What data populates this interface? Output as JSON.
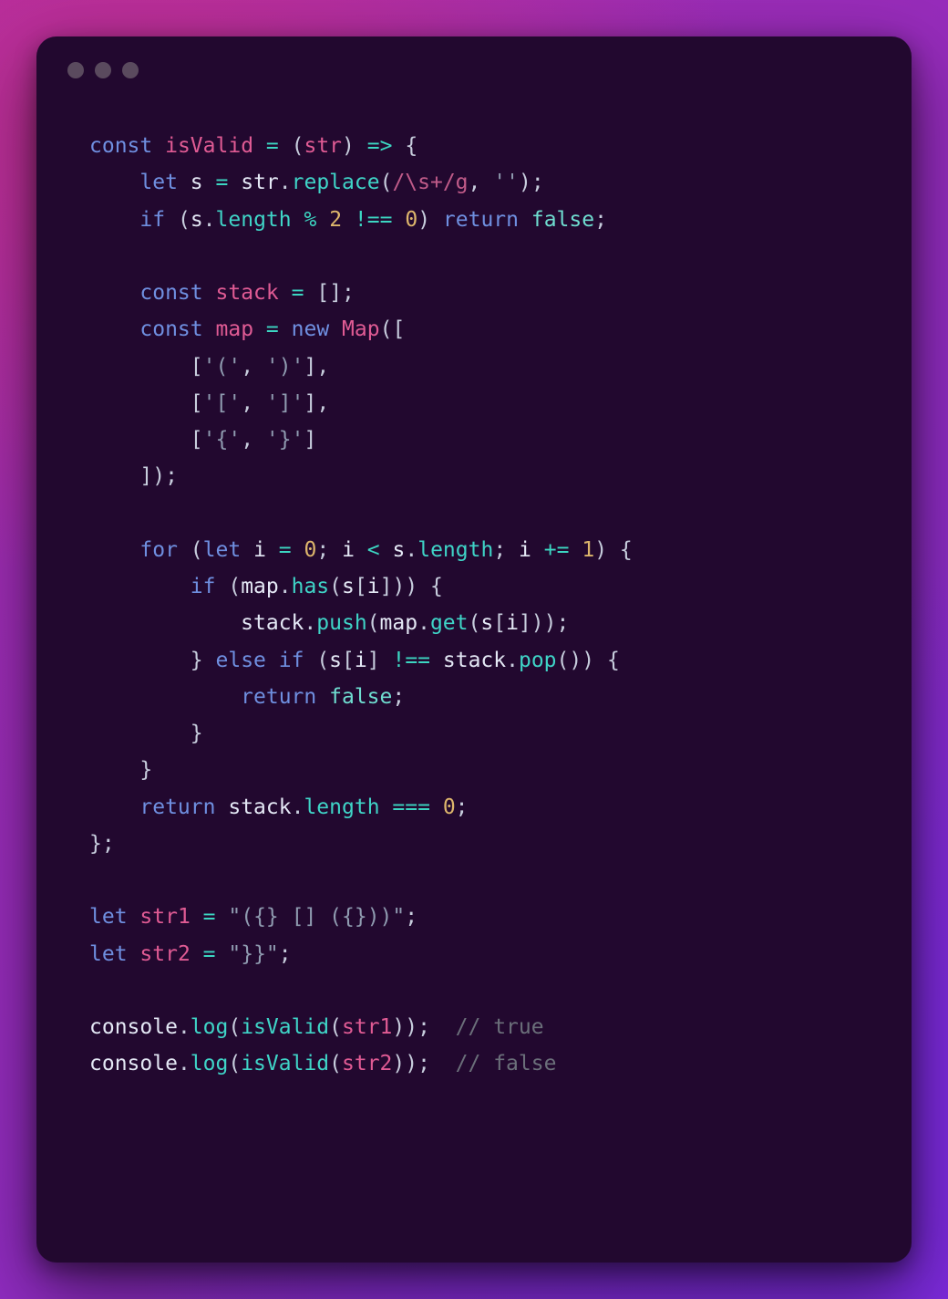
{
  "code": {
    "t1": "const",
    "t2": "isValid",
    "t3": "=",
    "t4": "(",
    "t5": "str",
    "t6": ")",
    "t7": "=>",
    "t8": "{",
    "t9": "let",
    "t10": "s",
    "t11": "=",
    "t12": "str",
    "t13": ".",
    "t14": "replace",
    "t15": "(",
    "t16": "/\\s+/g",
    "t17": ",",
    "t18": "''",
    "t19": ")",
    "t20": ";",
    "t21": "if",
    "t22": "(",
    "t23": "s",
    "t24": ".",
    "t25": "length",
    "t26": "%",
    "t27": "2",
    "t28": "!==",
    "t29": "0",
    "t30": ")",
    "t31": "return",
    "t32": "false",
    "t33": ";",
    "t34": "const",
    "t35": "stack",
    "t36": "=",
    "t37": "[",
    "t38": "]",
    "t39": ";",
    "t40": "const",
    "t41": "map",
    "t42": "=",
    "t43": "new",
    "t44": "Map",
    "t45": "(",
    "t46": "[",
    "t47": "[",
    "t48": "'('",
    "t49": ",",
    "t50": "')'",
    "t51": "]",
    "t52": ",",
    "t53": "[",
    "t54": "'['",
    "t55": ",",
    "t56": "']'",
    "t57": "]",
    "t58": ",",
    "t59": "[",
    "t60": "'{'",
    "t61": ",",
    "t62": "'}'",
    "t63": "]",
    "t64": "]",
    "t65": ")",
    "t66": ";",
    "t67": "for",
    "t68": "(",
    "t69": "let",
    "t70": "i",
    "t71": "=",
    "t72": "0",
    "t73": ";",
    "t74": "i",
    "t75": "<",
    "t76": "s",
    "t77": ".",
    "t78": "length",
    "t79": ";",
    "t80": "i",
    "t81": "+=",
    "t82": "1",
    "t83": ")",
    "t84": "{",
    "t85": "if",
    "t86": "(",
    "t87": "map",
    "t88": ".",
    "t89": "has",
    "t90": "(",
    "t91": "s",
    "t92": "[",
    "t93": "i",
    "t94": "]",
    "t95": ")",
    "t96": ")",
    "t97": "{",
    "t98": "stack",
    "t99": ".",
    "t100": "push",
    "t101": "(",
    "t102": "map",
    "t103": ".",
    "t104": "get",
    "t105": "(",
    "t106": "s",
    "t107": "[",
    "t108": "i",
    "t109": "]",
    "t110": ")",
    "t111": ")",
    "t112": ";",
    "t113": "}",
    "t114": "else",
    "t115": "if",
    "t116": "(",
    "t117": "s",
    "t118": "[",
    "t119": "i",
    "t120": "]",
    "t121": "!==",
    "t122": "stack",
    "t123": ".",
    "t124": "pop",
    "t125": "(",
    "t126": ")",
    "t127": ")",
    "t128": "{",
    "t129": "return",
    "t130": "false",
    "t131": ";",
    "t132": "}",
    "t133": "}",
    "t134": "return",
    "t135": "stack",
    "t136": ".",
    "t137": "length",
    "t138": "===",
    "t139": "0",
    "t140": ";",
    "t141": "}",
    "t142": ";",
    "t143": "let",
    "t144": "str1",
    "t145": "=",
    "t146": "\"({} [] ({}))\"",
    "t147": ";",
    "t148": "let",
    "t149": "str2",
    "t150": "=",
    "t151": "\"}}\"",
    "t152": ";",
    "t153": "console",
    "t154": ".",
    "t155": "log",
    "t156": "(",
    "t157": "isValid",
    "t158": "(",
    "t159": "str1",
    "t160": ")",
    "t161": ")",
    "t162": ";",
    "t163": "// true",
    "t164": "console",
    "t165": ".",
    "t166": "log",
    "t167": "(",
    "t168": "isValid",
    "t169": "(",
    "t170": "str2",
    "t171": ")",
    "t172": ")",
    "t173": ";",
    "t174": "// false"
  }
}
